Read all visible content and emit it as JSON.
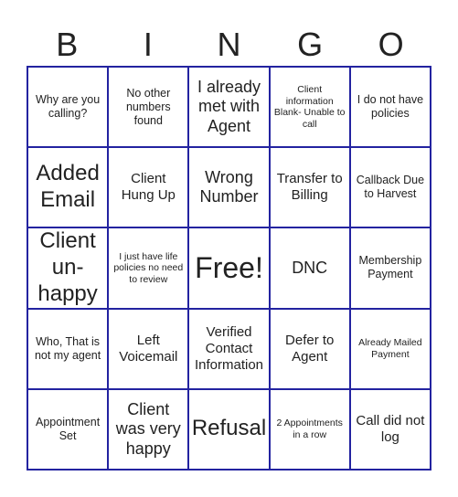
{
  "header": {
    "letters": [
      "B",
      "I",
      "N",
      "G",
      "O"
    ]
  },
  "board": {
    "rows": [
      [
        {
          "text": "Why are you calling?",
          "size": "s"
        },
        {
          "text": "No other numbers found",
          "size": "s"
        },
        {
          "text": "I already met with Agent",
          "size": "l"
        },
        {
          "text": "Client information Blank- Unable to call",
          "size": "xs"
        },
        {
          "text": "I do not have policies",
          "size": "s"
        }
      ],
      [
        {
          "text": "Added Email",
          "size": "xl"
        },
        {
          "text": "Client Hung Up",
          "size": "m"
        },
        {
          "text": "Wrong Number",
          "size": "l"
        },
        {
          "text": "Transfer to Billing",
          "size": "m"
        },
        {
          "text": "Callback Due to Harvest",
          "size": "s"
        }
      ],
      [
        {
          "text": "Client un-happy",
          "size": "xl"
        },
        {
          "text": "I just have life policies no need to review",
          "size": "xs"
        },
        {
          "text": "Free!",
          "size": "xxl"
        },
        {
          "text": "DNC",
          "size": "l"
        },
        {
          "text": "Membership Payment",
          "size": "s"
        }
      ],
      [
        {
          "text": "Who, That is not my agent",
          "size": "s"
        },
        {
          "text": "Left Voicemail",
          "size": "m"
        },
        {
          "text": "Verified Contact Information",
          "size": "m"
        },
        {
          "text": "Defer to Agent",
          "size": "m"
        },
        {
          "text": "Already Mailed Payment",
          "size": "xs"
        }
      ],
      [
        {
          "text": "Appointment Set",
          "size": "s"
        },
        {
          "text": "Client was very happy",
          "size": "l"
        },
        {
          "text": "Refusal",
          "size": "xl"
        },
        {
          "text": "2 Appointments in a row",
          "size": "xs"
        },
        {
          "text": "Call did not log",
          "size": "m"
        }
      ]
    ]
  },
  "colors": {
    "grid_border": "#2323a0",
    "text": "#222222",
    "background": "#ffffff"
  }
}
